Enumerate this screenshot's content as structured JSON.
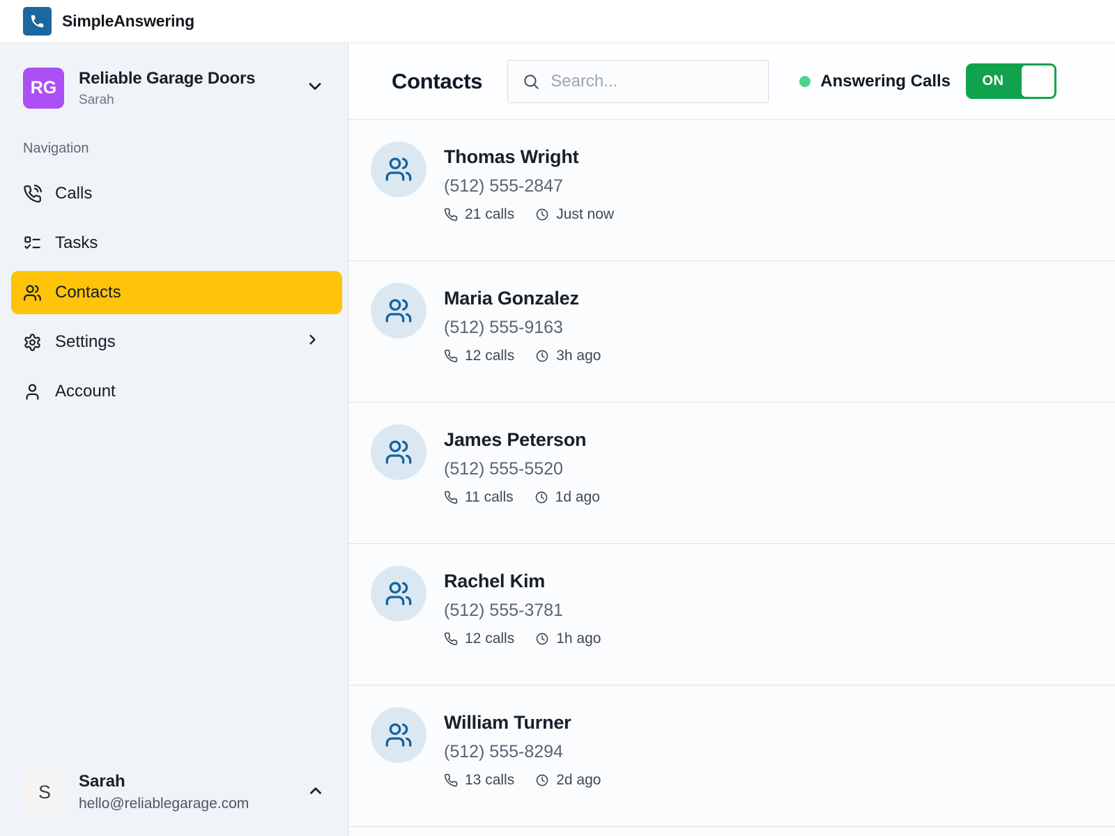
{
  "app": {
    "name": "SimpleAnswering"
  },
  "sidebar": {
    "org": {
      "initials": "RG",
      "name": "Reliable Garage Doors",
      "subtitle": "Sarah"
    },
    "section_label": "Navigation",
    "nav": [
      {
        "label": "Calls",
        "icon": "phone-call-icon"
      },
      {
        "label": "Tasks",
        "icon": "list-todo-icon"
      },
      {
        "label": "Contacts",
        "icon": "users-icon",
        "active": true
      },
      {
        "label": "Settings",
        "icon": "gear-icon"
      },
      {
        "label": "Account",
        "icon": "user-icon"
      }
    ],
    "user": {
      "initial": "S",
      "name": "Sarah",
      "email": "hello@reliablegarage.com"
    }
  },
  "header": {
    "title": "Contacts",
    "search_placeholder": "Search...",
    "status_label": "Answering Calls",
    "toggle_label": "ON",
    "toggle_state": "on"
  },
  "contacts": [
    {
      "name": "Thomas Wright",
      "phone": "(512) 555-2847",
      "calls": "21 calls",
      "last_contact": "Just now"
    },
    {
      "name": "Maria Gonzalez",
      "phone": "(512) 555-9163",
      "calls": "12 calls",
      "last_contact": "3h ago"
    },
    {
      "name": "James Peterson",
      "phone": "(512) 555-5520",
      "calls": "11 calls",
      "last_contact": "1d ago"
    },
    {
      "name": "Rachel Kim",
      "phone": "(512) 555-3781",
      "calls": "12 calls",
      "last_contact": "1h ago"
    },
    {
      "name": "William Turner",
      "phone": "(512) 555-8294",
      "calls": "13 calls",
      "last_contact": "2d ago"
    }
  ],
  "colors": {
    "brand_blue": "#1B67A0",
    "avatar_purple": "#AC50F5",
    "active_nav_yellow": "#FFC40A",
    "toggle_green": "#10A24C",
    "status_dot_green": "#4CD389",
    "contact_icon_blue": "#15639E",
    "sidebar_bg": "#F0F4F8"
  }
}
